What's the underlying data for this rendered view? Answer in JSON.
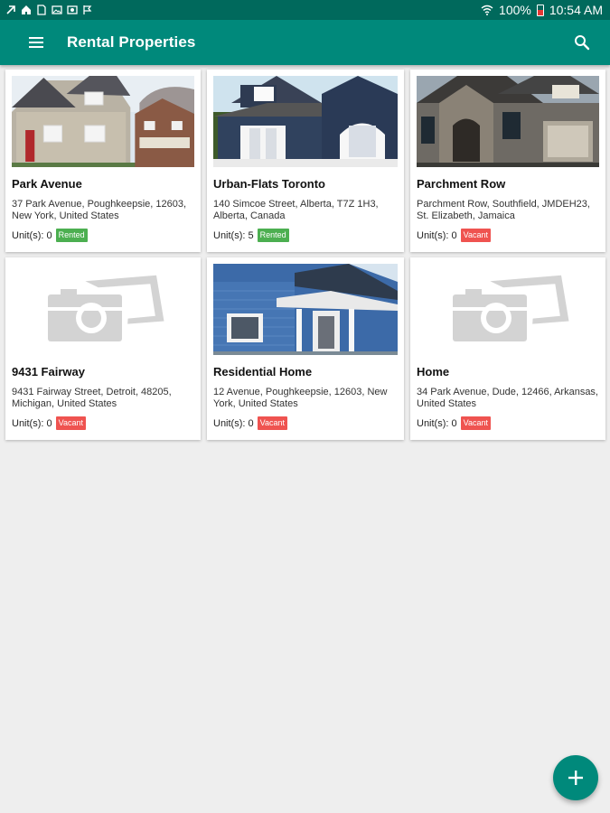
{
  "status_bar": {
    "battery": "100%",
    "time": "10:54 AM"
  },
  "app_bar": {
    "title": "Rental Properties",
    "menu_icon": "hamburger-menu-icon",
    "search_icon": "search-icon"
  },
  "colors": {
    "primary": "#00897b",
    "primary_dark": "#00695c",
    "rented": "#4caf50",
    "vacant": "#ef5350"
  },
  "properties": [
    {
      "name": "Park Avenue",
      "address": "37 Park Avenue, Poughkeepsie, 12603, New York, United States",
      "units_label": "Unit(s): 0",
      "status": "Rented",
      "image": "house-photo"
    },
    {
      "name": "Urban-Flats Toronto",
      "address": "140 Simcoe Street, Alberta, T7Z 1H3, Alberta, Canada",
      "units_label": "Unit(s): 5",
      "status": "Rented",
      "image": "house-photo"
    },
    {
      "name": "Parchment Row",
      "address": "Parchment Row, Southfield, JMDEH23, St. Elizabeth, Jamaica",
      "units_label": "Unit(s): 0",
      "status": "Vacant",
      "image": "house-photo"
    },
    {
      "name": "9431 Fairway",
      "address": "9431 Fairway Street, Detroit, 48205, Michigan, United States",
      "units_label": "Unit(s): 0",
      "status": "Vacant",
      "image": "camera-placeholder-icon"
    },
    {
      "name": "Residential Home",
      "address": "12 Avenue, Poughkeepsie, 12603, New York, United States",
      "units_label": "Unit(s): 0",
      "status": "Vacant",
      "image": "house-photo"
    },
    {
      "name": "Home",
      "address": "34 Park Avenue, Dude, 12466, Arkansas, United States",
      "units_label": "Unit(s): 0",
      "status": "Vacant",
      "image": "camera-placeholder-icon"
    }
  ],
  "fab": {
    "icon": "plus-icon"
  }
}
